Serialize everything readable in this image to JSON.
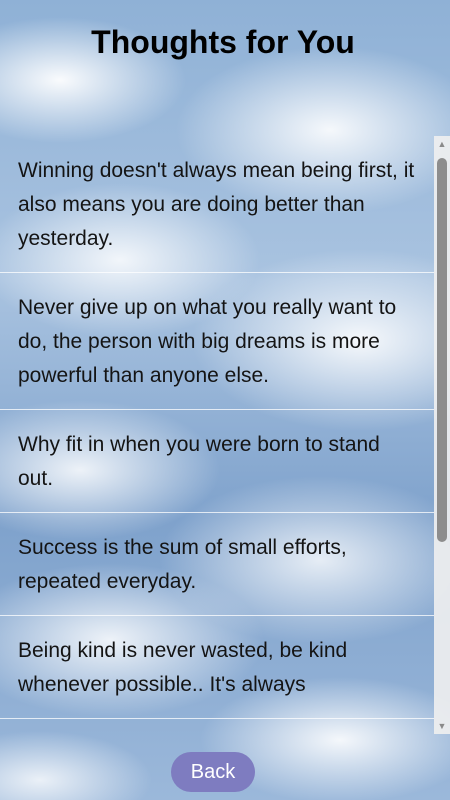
{
  "header": {
    "title": "Thoughts for You"
  },
  "quotes": [
    "Winning doesn't always mean being first, it also means you are doing better than yesterday.",
    "Never give up on what you really want to do, the person with big dreams is more powerful than anyone else.",
    "Why fit in when you were born to stand out.",
    "Success is the sum of small efforts, repeated everyday.",
    "Being kind is never wasted, be kind whenever possible.. It's always"
  ],
  "footer": {
    "back_label": "Back"
  },
  "colors": {
    "button": "#7e7cc0",
    "text": "#141414"
  },
  "icons": {
    "scroll_up": "triangle-up",
    "scroll_down": "triangle-down"
  }
}
